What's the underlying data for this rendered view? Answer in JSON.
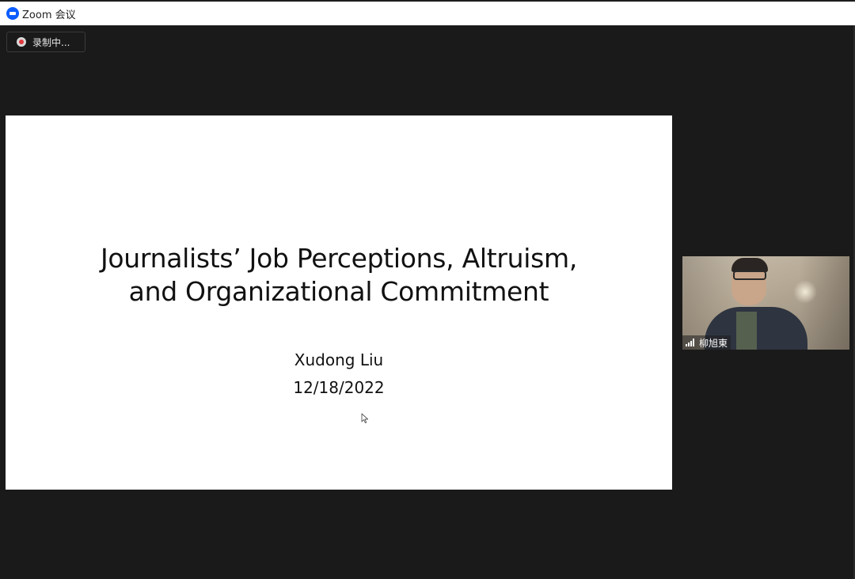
{
  "window": {
    "title": "Zoom 会议"
  },
  "recording": {
    "label": "录制中..."
  },
  "slide": {
    "title_line1": "Journalists’ Job Perceptions, Altruism,",
    "title_line2": "and Organizational Commitment",
    "author": "Xudong Liu",
    "date": "12/18/2022"
  },
  "participant": {
    "name": "柳旭東",
    "video": "camera-feed"
  },
  "colors": {
    "brand": "#0b5cff",
    "background": "#1a1a1a",
    "recording_dot": "#e0393e"
  },
  "icons": [
    "zoom-logo-icon",
    "recording-icon",
    "cursor-icon",
    "signal-strength-icon"
  ]
}
